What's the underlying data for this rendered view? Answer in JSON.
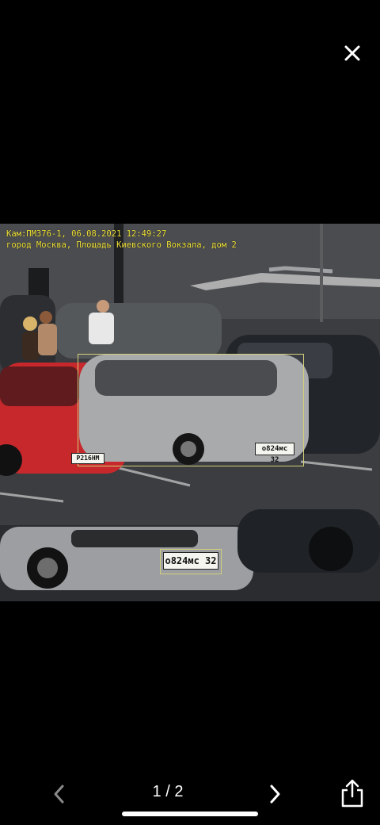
{
  "viewer": {
    "close_icon": "close-icon",
    "counter": "1 / 2",
    "prev_icon": "chevron-left-icon",
    "next_icon": "chevron-right-icon",
    "share_icon": "share-icon"
  },
  "photo": {
    "overlay_line1": "Кам:ПМ376-1, 06.08.2021 12:49:27",
    "overlay_line2": "город Москва, Площадь Киевского Вокзала, дом 2",
    "plate_main": "о824мс 32",
    "plate_small": "о824мс 32",
    "plate_red_car": "Р216НМ"
  },
  "colors": {
    "overlay_text": "#f2e33a",
    "box_outline": "#d3d07a",
    "background": "#000000"
  }
}
